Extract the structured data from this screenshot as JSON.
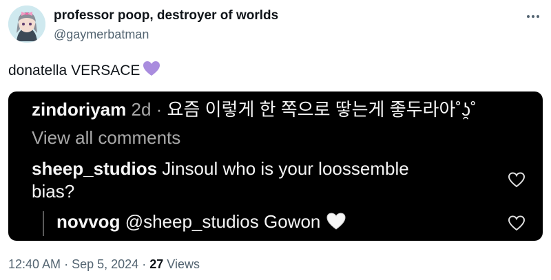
{
  "tweet": {
    "display_name": "professor poop, destroyer of worlds",
    "handle": "@gaymerbatman",
    "text": "donatella VERSACE",
    "emoji": "purple-heart"
  },
  "media": {
    "comment1": {
      "user": "zindoriyam",
      "time": "2d",
      "separator": "·",
      "text": "요즘 이렇게 한 쪽으로 땋는게 좋두라아",
      "emoticon": "˚ʖ̯˚"
    },
    "view_all": "View all comments",
    "comment2": {
      "user": "sheep_studios",
      "text_line1": "Jinsoul who is your loossemble",
      "text_line2": "bias?"
    },
    "reply": {
      "user": "novvog",
      "text": "@sheep_studios Gowon",
      "emoji": "white-heart"
    }
  },
  "footer": {
    "time": "12:40 AM",
    "sep1": "·",
    "date": "Sep 5, 2024",
    "sep2": "·",
    "views_count": "27",
    "views_label": "Views"
  },
  "colors": {
    "text_primary": "#0f1419",
    "text_secondary": "#536471",
    "media_bg": "#000000",
    "purple_heart": "#a98cde"
  }
}
